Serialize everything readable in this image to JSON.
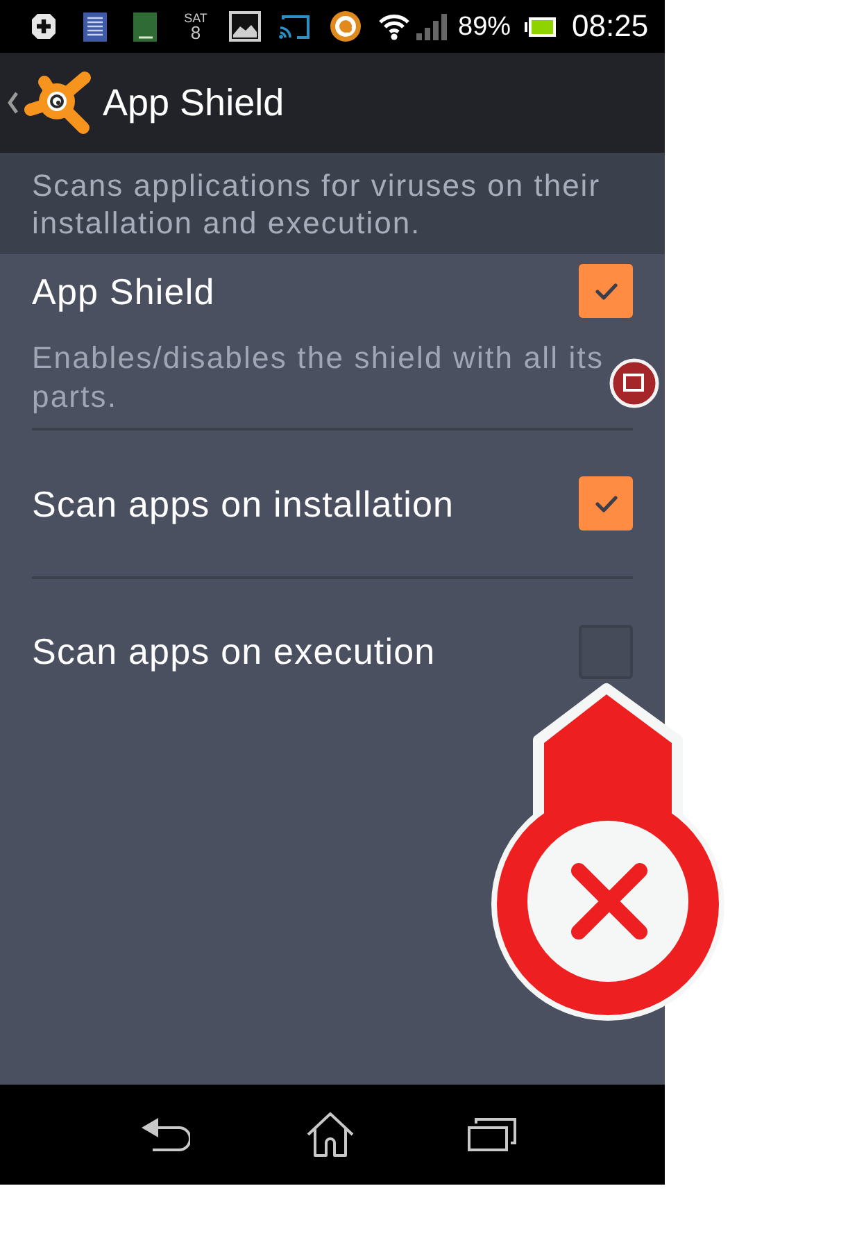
{
  "status_bar": {
    "day": "SAT",
    "date": "8",
    "battery": "89%",
    "time": "08:25"
  },
  "action_bar": {
    "title": "App Shield"
  },
  "description": "Scans applications for viruses on their installation and execution.",
  "settings": [
    {
      "title": "App Shield",
      "summary": "Enables/disables the shield with all its parts.",
      "checked": true
    },
    {
      "title": "Scan apps on installation",
      "checked": true
    },
    {
      "title": "Scan apps on execution",
      "checked": false
    }
  ]
}
